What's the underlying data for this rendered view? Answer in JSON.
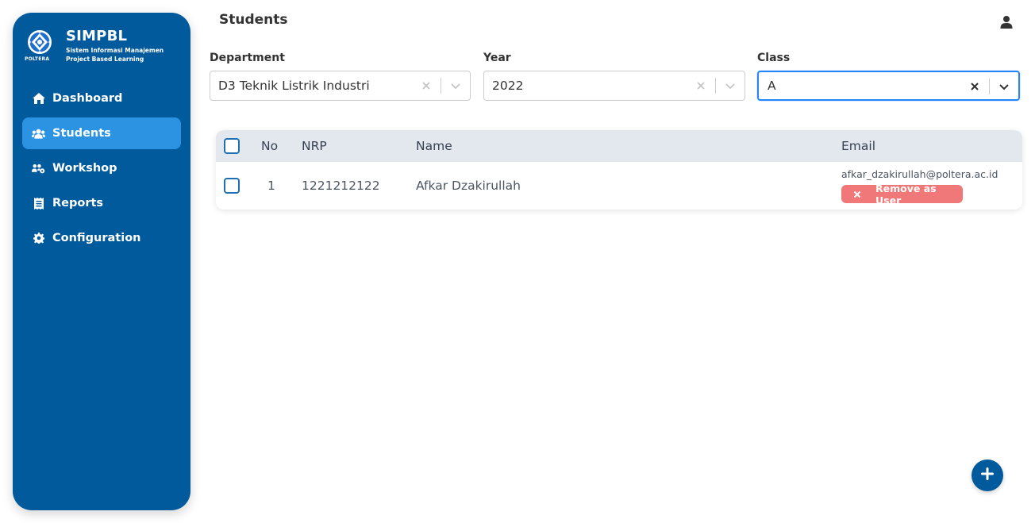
{
  "app": {
    "name": "SIMPBL",
    "subtitle_line1": "Sistem Informasi Manajemen",
    "subtitle_line2": "Project Based Learning",
    "logo_text": "POLTERA"
  },
  "sidebar": {
    "items": [
      {
        "label": "Dashboard",
        "icon": "home-icon",
        "active": false
      },
      {
        "label": "Students",
        "icon": "users-icon",
        "active": true
      },
      {
        "label": "Workshop",
        "icon": "users-cog-icon",
        "active": false
      },
      {
        "label": "Reports",
        "icon": "receipt-icon",
        "active": false
      },
      {
        "label": "Configuration",
        "icon": "gear-icon",
        "active": false
      }
    ]
  },
  "header": {
    "title": "Students",
    "user_icon": "user-icon"
  },
  "filters": {
    "department": {
      "label": "Department",
      "value": "D3 Teknik Listrik Industri"
    },
    "year": {
      "label": "Year",
      "value": "2022"
    },
    "class": {
      "label": "Class",
      "value": "A"
    }
  },
  "table": {
    "columns": [
      "No",
      "NRP",
      "Name",
      "Email"
    ],
    "rows": [
      {
        "no": "1",
        "nrp": "1221212122",
        "name": "Afkar Dzakirullah",
        "email": "afkar_dzakirullah@poltera.ac.id",
        "action_label": "Remove as User"
      }
    ]
  },
  "fab": {
    "icon": "plus-icon"
  },
  "colors": {
    "sidebar_bg": "#005a9c",
    "active_item": "#2b93e2",
    "danger": "#f07878",
    "focus_border": "#2684ff"
  }
}
